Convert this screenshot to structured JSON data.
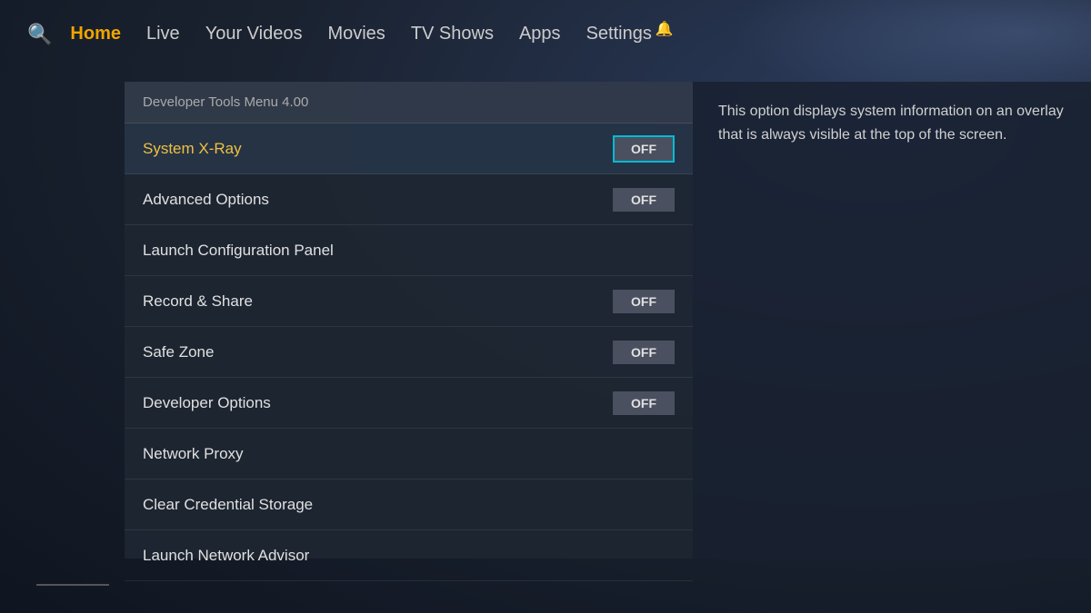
{
  "nav": {
    "items": [
      {
        "id": "home",
        "label": "Home",
        "active": true
      },
      {
        "id": "live",
        "label": "Live",
        "active": false
      },
      {
        "id": "your-videos",
        "label": "Your Videos",
        "active": false
      },
      {
        "id": "movies",
        "label": "Movies",
        "active": false
      },
      {
        "id": "tv-shows",
        "label": "TV Shows",
        "active": false
      },
      {
        "id": "apps",
        "label": "Apps",
        "active": false
      },
      {
        "id": "settings",
        "label": "Settings",
        "active": false
      }
    ]
  },
  "menu": {
    "header": "Developer Tools Menu 4.00",
    "items": [
      {
        "id": "system-xray",
        "label": "System X-Ray",
        "toggle": "OFF",
        "hasToggle": true,
        "selected": true
      },
      {
        "id": "advanced-options",
        "label": "Advanced Options",
        "toggle": "OFF",
        "hasToggle": true,
        "selected": false
      },
      {
        "id": "launch-config",
        "label": "Launch Configuration Panel",
        "toggle": null,
        "hasToggle": false,
        "selected": false
      },
      {
        "id": "record-share",
        "label": "Record & Share",
        "toggle": "OFF",
        "hasToggle": true,
        "selected": false
      },
      {
        "id": "safe-zone",
        "label": "Safe Zone",
        "toggle": "OFF",
        "hasToggle": true,
        "selected": false
      },
      {
        "id": "developer-options",
        "label": "Developer Options",
        "toggle": "OFF",
        "hasToggle": true,
        "selected": false
      },
      {
        "id": "network-proxy",
        "label": "Network Proxy",
        "toggle": null,
        "hasToggle": false,
        "selected": false
      },
      {
        "id": "clear-credential",
        "label": "Clear Credential Storage",
        "toggle": null,
        "hasToggle": false,
        "selected": false
      },
      {
        "id": "launch-network",
        "label": "Launch Network Advisor",
        "toggle": null,
        "hasToggle": false,
        "selected": false
      }
    ]
  },
  "description": {
    "text": "This option displays system information on an overlay that is always visible at the top of the screen."
  }
}
